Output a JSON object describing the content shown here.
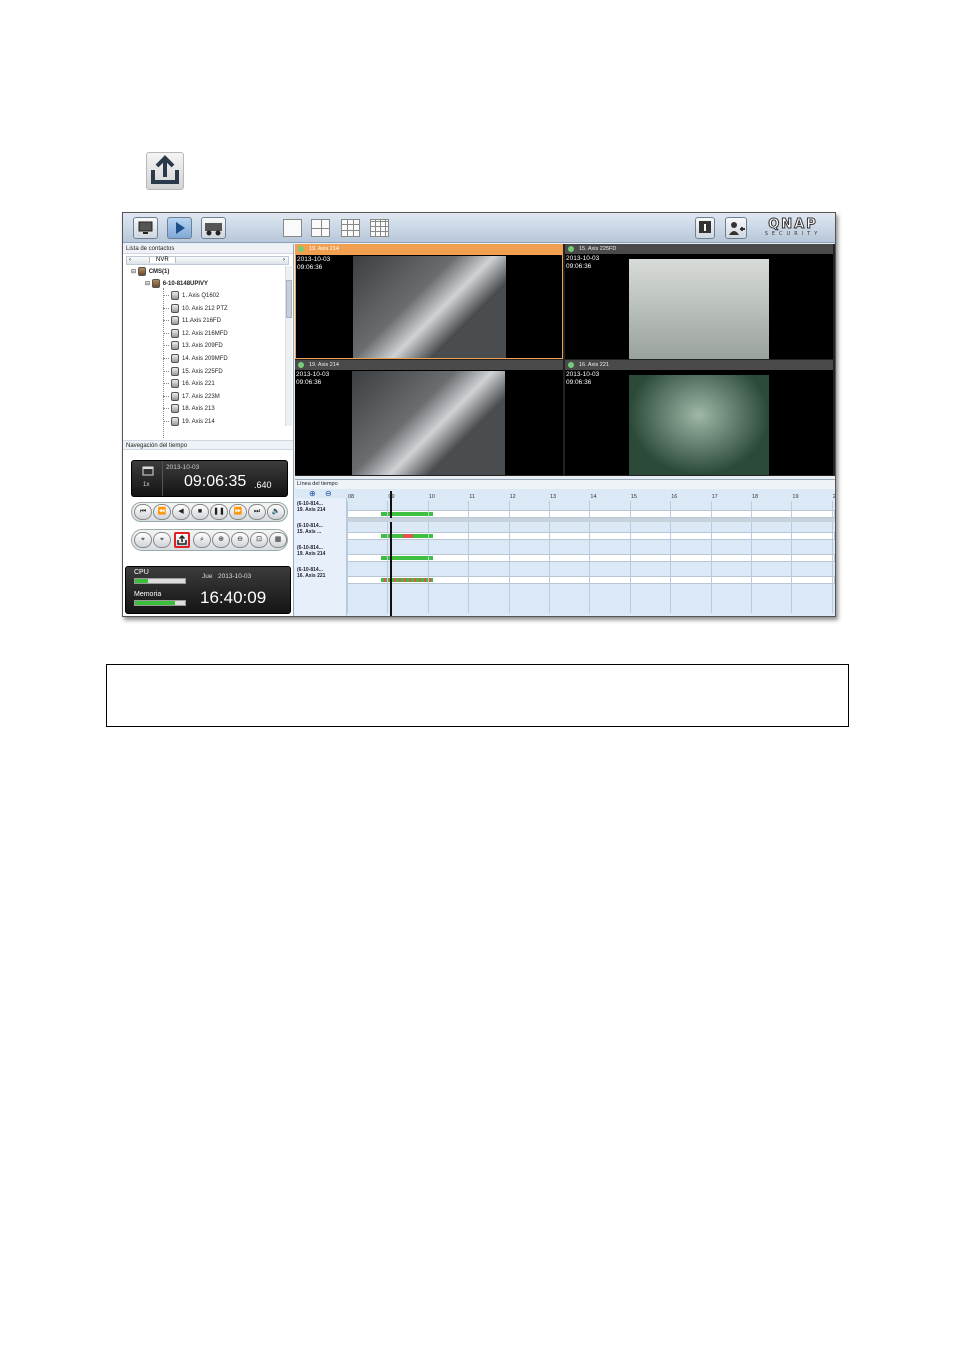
{
  "toolbar_tooltip_icon": "export-icon",
  "app": {
    "contacts_title": "Lista de contactos",
    "tab_label": "NVR",
    "tree": {
      "root": "CMS(1)",
      "server": "6-10-8148UPIVY",
      "cameras": [
        "1. Axis Q1602",
        "10. Axis 212 PTZ",
        "11.Axis 216FD",
        "12. Axis 216MFD",
        "13. Axis 209FD",
        "14. Axis 209MFD",
        "15. Axis 225FD",
        "16. Axis 221",
        "17. Axis 223M",
        "18. Axis 213",
        "19. Axis 214"
      ]
    },
    "time_nav": {
      "title": "Navegación del tiempo",
      "date": "2013-10-03",
      "time_main": "09:06:35",
      "time_ms": ".640",
      "speed": "1x"
    },
    "status": {
      "cpu_label": "CPU",
      "mem_label": "Memoria",
      "day": "Jue",
      "date": "2013-10-03",
      "clock": "16:40:09",
      "cpu_usage": 0.25,
      "mem_usage": 0.8
    },
    "logo": "QNAP",
    "logo_sub": "SECURITY",
    "grid": [
      {
        "name": "19. Axis 214",
        "date": "2013-10-03",
        "time": "09:06:36",
        "selected": true
      },
      {
        "name": "15. Axis 225FD",
        "date": "2013-10-03",
        "time": "09:06:36",
        "selected": false
      },
      {
        "name": "19. Axis 214",
        "date": "2013-10-03",
        "time": "09:06:36",
        "selected": false
      },
      {
        "name": "16. Axis 221",
        "date": "2013-10-03",
        "time": "09:06:36",
        "selected": false
      }
    ],
    "timeline": {
      "title": "Línea del tiempo",
      "hours": [
        "08",
        "09",
        "10",
        "11",
        "12",
        "13",
        "14",
        "15",
        "16",
        "17",
        "18",
        "19",
        "2"
      ],
      "rows": [
        {
          "server": "(6-10-814...",
          "camera": "19. Axis 214"
        },
        {
          "server": "(6-10-814...",
          "camera": "15. Axis ..."
        },
        {
          "server": "(6-10-814...",
          "camera": "19. Axis 214"
        },
        {
          "server": "(6-10-814...",
          "camera": "16. Axis 221"
        }
      ]
    }
  }
}
